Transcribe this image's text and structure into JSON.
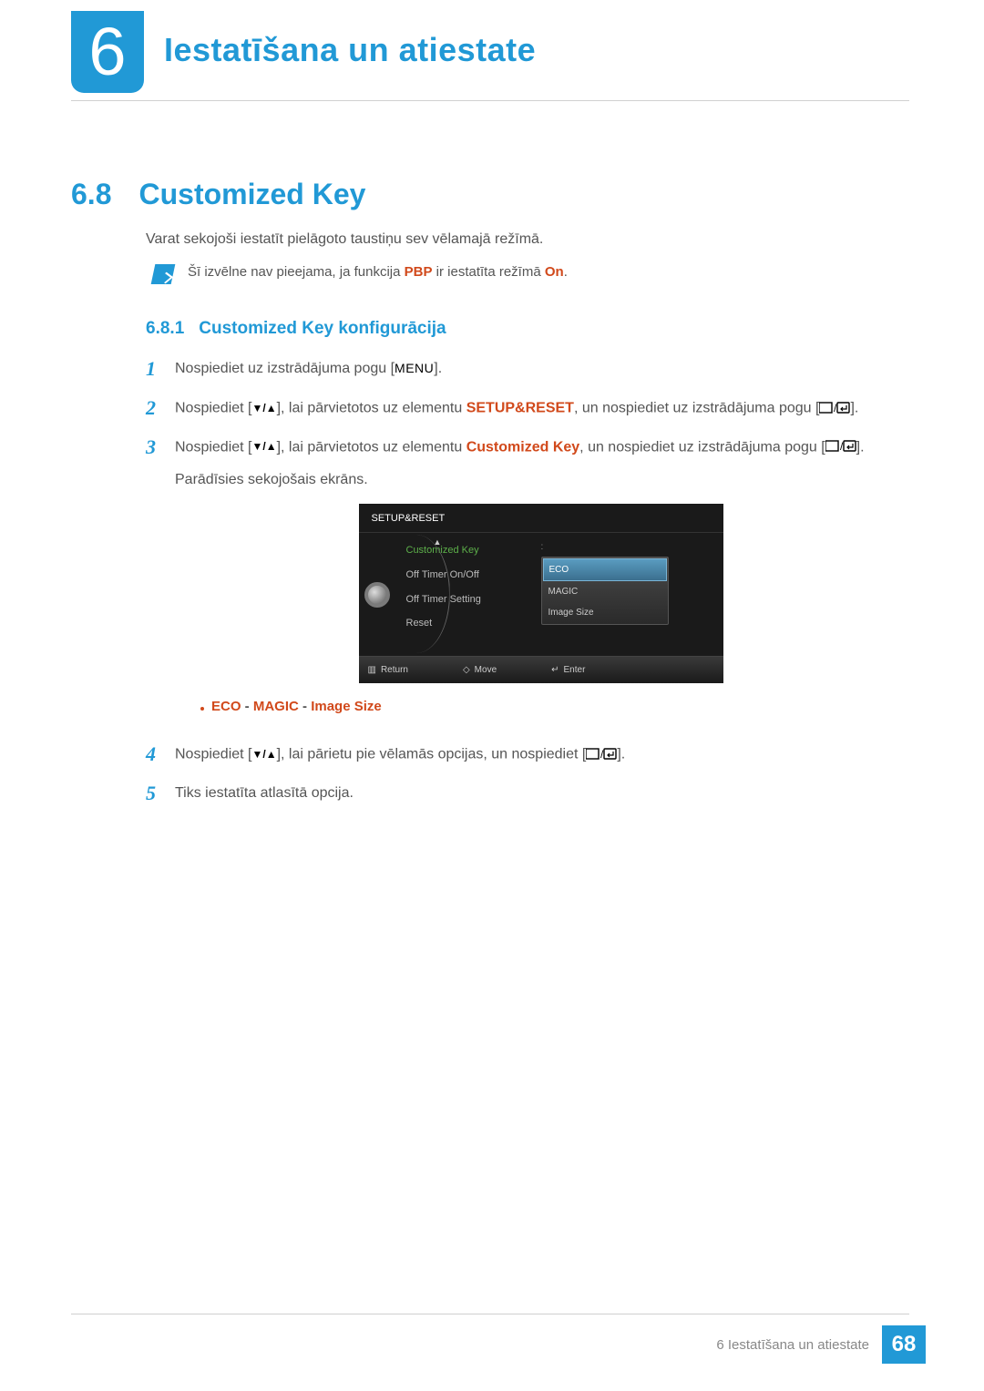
{
  "chapter": {
    "num": "6",
    "title": "Iestatīšana un atiestate"
  },
  "section": {
    "num": "6.8",
    "title": "Customized Key"
  },
  "intro": "Varat sekojoši iestatīt pielāgoto taustiņu sev vēlamajā režīmā.",
  "note": {
    "pre": "Šī izvēlne nav pieejama, ja funkcija ",
    "hl1": "PBP",
    "mid": " ir iestatīta režīmā ",
    "hl2": "On",
    "post": "."
  },
  "sub": {
    "num": "6.8.1",
    "title": "Customized Key konfigurācija"
  },
  "steps": {
    "s1": {
      "num": "1",
      "pre": "Nospiediet uz izstrādājuma pogu [",
      "btn": "MENU",
      "post": "]."
    },
    "s2": {
      "num": "2",
      "pre": "Nospiediet [",
      "mid1": "], lai pārvietotos uz elementu ",
      "hl": "SETUP&RESET",
      "mid2": ", un nospiediet uz izstrādājuma pogu [",
      "post": "]."
    },
    "s3": {
      "num": "3",
      "pre": "Nospiediet [",
      "mid1": "], lai pārvietotos uz elementu ",
      "hl": "Customized Key",
      "mid2": ", un nospiediet uz izstrādājuma pogu [",
      "post": "].",
      "extra": "Parādīsies sekojošais ekrāns."
    },
    "bullet": {
      "a": "ECO",
      "sep1": " - ",
      "b": "MAGIC",
      "sep2": " - ",
      "c": "Image Size"
    },
    "s4": {
      "num": "4",
      "pre": "Nospiediet [",
      "mid1": "], lai pārietu pie vēlamās opcijas, un nospiediet [",
      "post": "]."
    },
    "s5": {
      "num": "5",
      "text": "Tiks iestatīta atlasītā opcija."
    }
  },
  "osd": {
    "title": "SETUP&RESET",
    "left": {
      "a": "Customized Key",
      "b": "Off Timer On/Off",
      "c": "Off Timer Setting",
      "d": "Reset"
    },
    "colon": ":",
    "right": {
      "a": "ECO",
      "b": "MAGIC",
      "c": "Image Size"
    },
    "footer": {
      "return": "Return",
      "move": "Move",
      "enter": "Enter"
    }
  },
  "footer": {
    "text": "6 Iestatīšana un atiestate",
    "page": "68"
  }
}
